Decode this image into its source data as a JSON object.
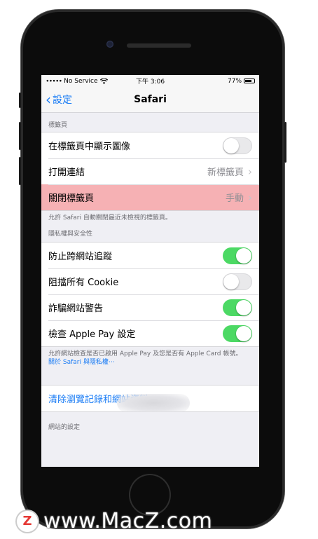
{
  "status_bar": {
    "carrier": "No Service",
    "time": "下午 3:06",
    "battery": "77%",
    "battery_level": 0.77
  },
  "nav": {
    "back_label": "設定",
    "title": "Safari"
  },
  "tabs_section": {
    "header": "標籤頁",
    "rows": [
      {
        "label": "在標籤頁中顯示圖像",
        "toggle": "off"
      },
      {
        "label": "打開連結",
        "value": "新標籤頁"
      },
      {
        "label": "關閉標籤頁",
        "value": "手動"
      }
    ],
    "footnote": "允許 Safari 自動關閉最近未檢視的標籤頁。"
  },
  "privacy_section": {
    "header": "隱私權與安全性",
    "rows": [
      {
        "label": "防止跨網站追蹤",
        "toggle": "on"
      },
      {
        "label": "阻擋所有 Cookie",
        "toggle": "off"
      },
      {
        "label": "詐騙網站警告",
        "toggle": "on"
      },
      {
        "label": "檢查 Apple Pay 設定",
        "toggle": "on"
      }
    ],
    "footnote": "允許網站檢查是否已啟用 Apple Pay 及您是否有 Apple Card 帳號。",
    "link": "關於 Safari 與隱私權⋯"
  },
  "clear_row": {
    "label": "清除瀏覽記錄和網站資料"
  },
  "website_section": {
    "header": "網站的設定"
  },
  "watermark": {
    "logo": "Z",
    "text": "www.MacZ.com"
  },
  "colors": {
    "accent": "#1a7cf5",
    "toggle_on": "#4cd964",
    "highlight": "#f6b1b4"
  }
}
